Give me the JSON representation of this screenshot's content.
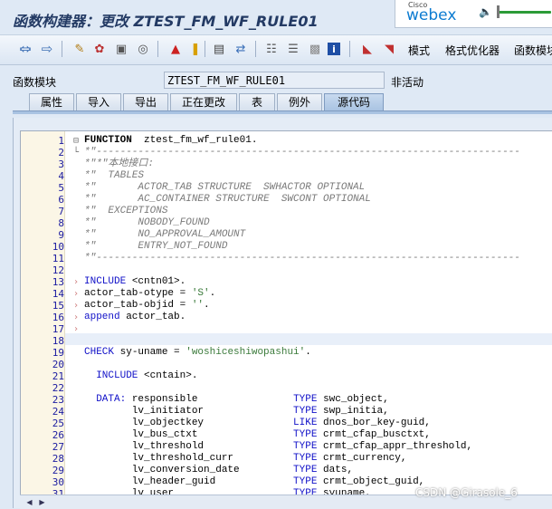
{
  "window": {
    "title": "函数构建器：更改 ZTEST_FM_WF_RULE01"
  },
  "webex": {
    "brand_top": "Cisco",
    "brand": "webex"
  },
  "toolbar": {
    "icons": [
      "back-arrow-icon",
      "forward-arrow-icon",
      "other-object-icon",
      "display-change-icon",
      "activate-icon",
      "check-icon",
      "where-used-icon",
      "test-icon",
      "object-list-icon",
      "navigation-window-icon",
      "hierarchy-icon",
      "inactive-objects-icon",
      "help-icon",
      "info-icon",
      "save-pattern-icon",
      "pattern-icon"
    ],
    "pattern_label": "模式",
    "pretty_printer_label": "格式优化器",
    "function_module_label": "函数模块"
  },
  "module": {
    "label": "函数模块",
    "value": "ZTEST_FM_WF_RULE01",
    "status": "非活动"
  },
  "tabs": [
    {
      "label": "属性"
    },
    {
      "label": "导入"
    },
    {
      "label": "导出"
    },
    {
      "label": "正在更改"
    },
    {
      "label": "表"
    },
    {
      "label": "例外"
    },
    {
      "label": "源代码"
    }
  ],
  "editor": {
    "lines": [
      {
        "n": "1",
        "segments": [
          [
            "kwb",
            "FUNCTION"
          ],
          [
            "",
            "  ztest_fm_wf_rule01."
          ]
        ]
      },
      {
        "n": "2",
        "segments": [
          [
            "cm",
            "*\"-----------------------------------------------------------------------"
          ]
        ]
      },
      {
        "n": "3",
        "segments": [
          [
            "cm",
            "*\"*\"本地接口:"
          ]
        ]
      },
      {
        "n": "4",
        "segments": [
          [
            "cm",
            "*\"  TABLES"
          ]
        ]
      },
      {
        "n": "5",
        "segments": [
          [
            "cm",
            "*\"       ACTOR_TAB STRUCTURE  SWHACTOR OPTIONAL"
          ]
        ]
      },
      {
        "n": "6",
        "segments": [
          [
            "cm",
            "*\"       AC_CONTAINER STRUCTURE  SWCONT OPTIONAL"
          ]
        ]
      },
      {
        "n": "7",
        "segments": [
          [
            "cm",
            "*\"  EXCEPTIONS"
          ]
        ]
      },
      {
        "n": "8",
        "segments": [
          [
            "cm",
            "*\"       NOBODY_FOUND"
          ]
        ]
      },
      {
        "n": "9",
        "segments": [
          [
            "cm",
            "*\"       NO_APPROVAL_AMOUNT"
          ]
        ]
      },
      {
        "n": "10",
        "segments": [
          [
            "cm",
            "*\"       ENTRY_NOT_FOUND"
          ]
        ]
      },
      {
        "n": "11",
        "segments": [
          [
            "cm",
            "*\"-----------------------------------------------------------------------"
          ]
        ]
      },
      {
        "n": "12",
        "segments": [
          [
            "",
            ""
          ]
        ]
      },
      {
        "n": "13",
        "segments": [
          [
            "kw",
            "INCLUDE"
          ],
          [
            "",
            " <cntn01>."
          ]
        ]
      },
      {
        "n": "14",
        "segments": [
          [
            "",
            "actor_tab-otype = "
          ],
          [
            "str",
            "'S'"
          ],
          [
            "",
            "."
          ]
        ]
      },
      {
        "n": "15",
        "segments": [
          [
            "",
            "actor_tab-objid = "
          ],
          [
            "str",
            "''"
          ],
          [
            "",
            "."
          ]
        ]
      },
      {
        "n": "16",
        "segments": [
          [
            "kw",
            "append"
          ],
          [
            "",
            " actor_tab."
          ]
        ]
      },
      {
        "n": "17",
        "segments": [
          [
            "",
            ""
          ]
        ]
      },
      {
        "n": "18",
        "segments": [
          [
            "",
            ""
          ]
        ]
      },
      {
        "n": "19",
        "segments": [
          [
            "kw",
            "CHECK"
          ],
          [
            "",
            " sy-uname = "
          ],
          [
            "str",
            "'woshiceshiwopashui'"
          ],
          [
            "",
            "."
          ]
        ]
      },
      {
        "n": "20",
        "segments": [
          [
            "",
            ""
          ]
        ]
      },
      {
        "n": "21",
        "segments": [
          [
            "",
            "  "
          ],
          [
            "kw",
            "INCLUDE"
          ],
          [
            "",
            " <cntain>."
          ]
        ]
      },
      {
        "n": "22",
        "segments": [
          [
            "",
            ""
          ]
        ]
      },
      {
        "n": "23",
        "segments": [
          [
            "",
            "  "
          ],
          [
            "kw",
            "DATA:"
          ],
          [
            "",
            " responsible                "
          ],
          [
            "kw",
            "TYPE"
          ],
          [
            "",
            " swc_object,"
          ]
        ]
      },
      {
        "n": "24",
        "segments": [
          [
            "",
            "        lv_initiator               "
          ],
          [
            "kw",
            "TYPE"
          ],
          [
            "",
            " swp_initia,"
          ]
        ]
      },
      {
        "n": "25",
        "segments": [
          [
            "",
            "        lv_objectkey               "
          ],
          [
            "kw",
            "LIKE"
          ],
          [
            "",
            " dnos_bor_key-guid,"
          ]
        ]
      },
      {
        "n": "26",
        "segments": [
          [
            "",
            "        lv_bus_ctxt                "
          ],
          [
            "kw",
            "TYPE"
          ],
          [
            "",
            " crmt_cfap_busctxt,"
          ]
        ]
      },
      {
        "n": "27",
        "segments": [
          [
            "",
            "        lv_threshold               "
          ],
          [
            "kw",
            "TYPE"
          ],
          [
            "",
            " crmt_cfap_appr_threshold,"
          ]
        ]
      },
      {
        "n": "28",
        "segments": [
          [
            "",
            "        lv_threshold_curr          "
          ],
          [
            "kw",
            "TYPE"
          ],
          [
            "",
            " crmt_currency,"
          ]
        ]
      },
      {
        "n": "29",
        "segments": [
          [
            "",
            "        lv_conversion_date         "
          ],
          [
            "kw",
            "TYPE"
          ],
          [
            "",
            " dats,"
          ]
        ]
      },
      {
        "n": "30",
        "segments": [
          [
            "",
            "        lv_header_guid             "
          ],
          [
            "kw",
            "TYPE"
          ],
          [
            "",
            " crmt_object_guid,"
          ]
        ]
      },
      {
        "n": "31",
        "segments": [
          [
            "",
            "        lv_user                    "
          ],
          [
            "kw",
            "TYPE"
          ],
          [
            "",
            " syuname,"
          ]
        ]
      }
    ]
  },
  "watermark": "CSDN @Girasole_6"
}
